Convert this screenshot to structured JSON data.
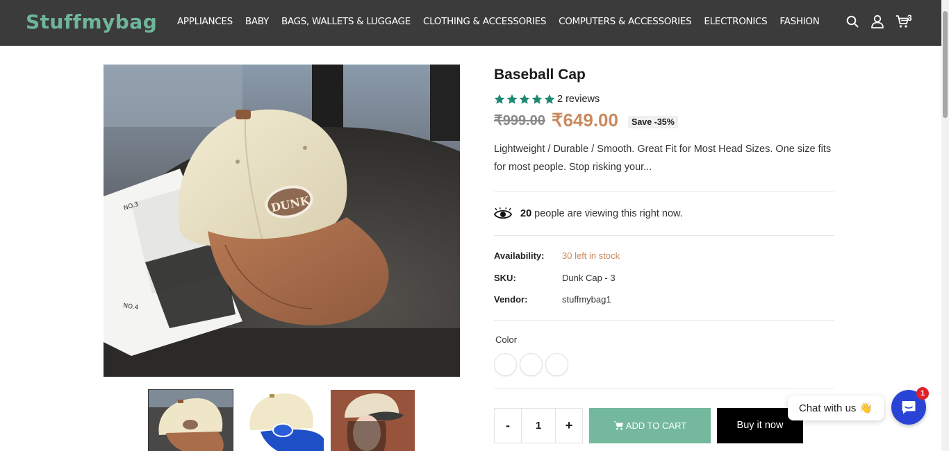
{
  "header": {
    "logo": "Stuffmybag",
    "nav": [
      "APPLIANCES",
      "BABY",
      "BAGS, WALLETS & LUGGAGE",
      "CLOTHING & ACCESSORIES",
      "COMPUTERS & ACCESSORIES",
      "ELECTRONICS",
      "FASHION"
    ],
    "icons": [
      "search-icon",
      "user-icon",
      "cart-icon"
    ],
    "cart_count": "3"
  },
  "product": {
    "title": "Baseball Cap",
    "rating_stars": 5,
    "reviews": "2 reviews",
    "old_price": "₹999.00",
    "new_price": "₹649.00",
    "save": "Save -35%",
    "description": "Lightweight / Durable / Smooth. Great Fit for Most Head Sizes. One size fits for most people. Stop risking your...",
    "viewing_count": "20",
    "viewing_text": "people are viewing this right now.",
    "availability_label": "Availability:",
    "availability_value": "30 left in stock",
    "sku_label": "SKU:",
    "sku_value": "Dunk Cap - 3",
    "vendor_label": "Vendor:",
    "vendor_value": "stuffmybag1",
    "color_label": "Color",
    "swatch_count": 3,
    "qty_minus": "-",
    "qty_value": "1",
    "qty_plus": "+",
    "add_to_cart": "ADD TO CART",
    "buy_now": "Buy it now",
    "cap_patch_text": "DUNK",
    "paper_labels": [
      "NO.3",
      "NO.4"
    ]
  },
  "chat": {
    "label": "Chat with us",
    "emoji": "👋",
    "badge": "1"
  },
  "colors": {
    "header_bg": "#3b3b3b",
    "logo": "#6fb59a",
    "star": "#1f8a73",
    "price": "#c98a5e",
    "add_to_cart_bg": "#74b99d",
    "chat_button": "#2943d6"
  }
}
